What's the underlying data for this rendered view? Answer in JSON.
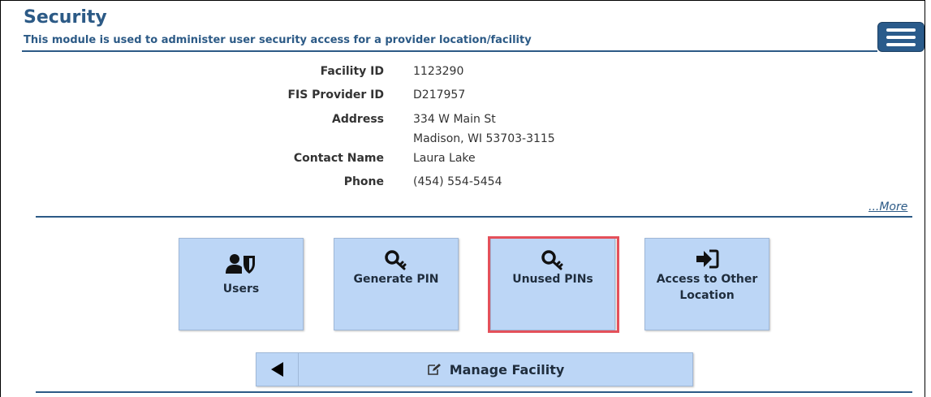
{
  "header": {
    "title": "Security",
    "subtitle": "This module is used to administer user security access for a provider location/facility"
  },
  "facility": {
    "rows": [
      {
        "label": "Facility ID",
        "value": "1123290"
      },
      {
        "label": "FIS Provider ID",
        "value": "D217957"
      },
      {
        "label": "Address",
        "value": "334 W Main St",
        "value2": "Madison, WI 53703-3115"
      },
      {
        "label": "Contact Name",
        "value": "Laura Lake"
      },
      {
        "label": "Phone",
        "value": "(454) 554-5454"
      }
    ],
    "more_link": "...More"
  },
  "tiles": [
    {
      "label": "Users",
      "icon": "user-shield-icon"
    },
    {
      "label": "Generate PIN",
      "icon": "key-icon"
    },
    {
      "label": "Unused PINs",
      "icon": "key-icon",
      "highlighted": true
    },
    {
      "label": "Access to Other Location",
      "icon": "sign-in-icon"
    }
  ],
  "manage": {
    "label": "Manage Facility",
    "icon": "edit-icon",
    "back_icon": "back-arrow-icon"
  },
  "colors": {
    "brand": "#2c5a86",
    "tile_bg": "#bcd6f6",
    "highlight": "#e4505a"
  }
}
